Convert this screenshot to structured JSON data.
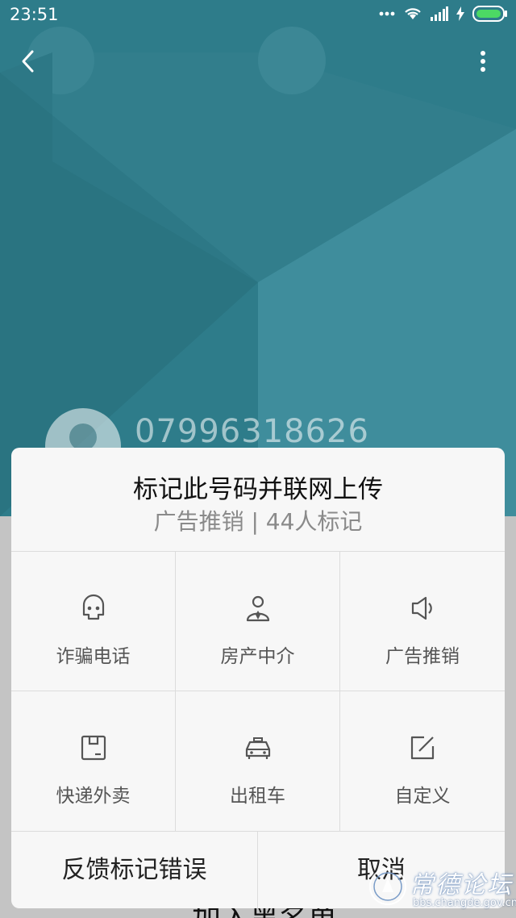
{
  "status_bar": {
    "time": "23:51",
    "icons": [
      "more-dots-icon",
      "wifi-icon",
      "signal-icon",
      "charging-icon",
      "battery-icon"
    ]
  },
  "nav": {
    "back_icon": "chevron-left-icon",
    "more_icon": "vertical-dots-icon"
  },
  "contact": {
    "avatar_icon": "person-avatar-icon",
    "phone_number": "07996318626"
  },
  "dialog": {
    "title": "标记此号码并联网上传",
    "subtitle": "广告推销 | 44人标记",
    "options": [
      {
        "label": "诈骗电话",
        "icon": "fraud-mask-icon"
      },
      {
        "label": "房产中介",
        "icon": "agent-person-icon"
      },
      {
        "label": "广告推销",
        "icon": "megaphone-icon"
      },
      {
        "label": "快递外卖",
        "icon": "package-box-icon"
      },
      {
        "label": "出租车",
        "icon": "taxi-icon"
      },
      {
        "label": "自定义",
        "icon": "edit-square-icon"
      }
    ],
    "feedback_label": "反馈标记错误",
    "cancel_label": "取消"
  },
  "behind": {
    "partial_text": "加入黑名单"
  },
  "watermark": {
    "title": "常德论坛",
    "url": "bbs.changde.gov.cn"
  },
  "colors": {
    "header_teal": "#2e7c8a",
    "dialog_bg": "#f7f7f7",
    "divider": "#dcdcdc"
  }
}
